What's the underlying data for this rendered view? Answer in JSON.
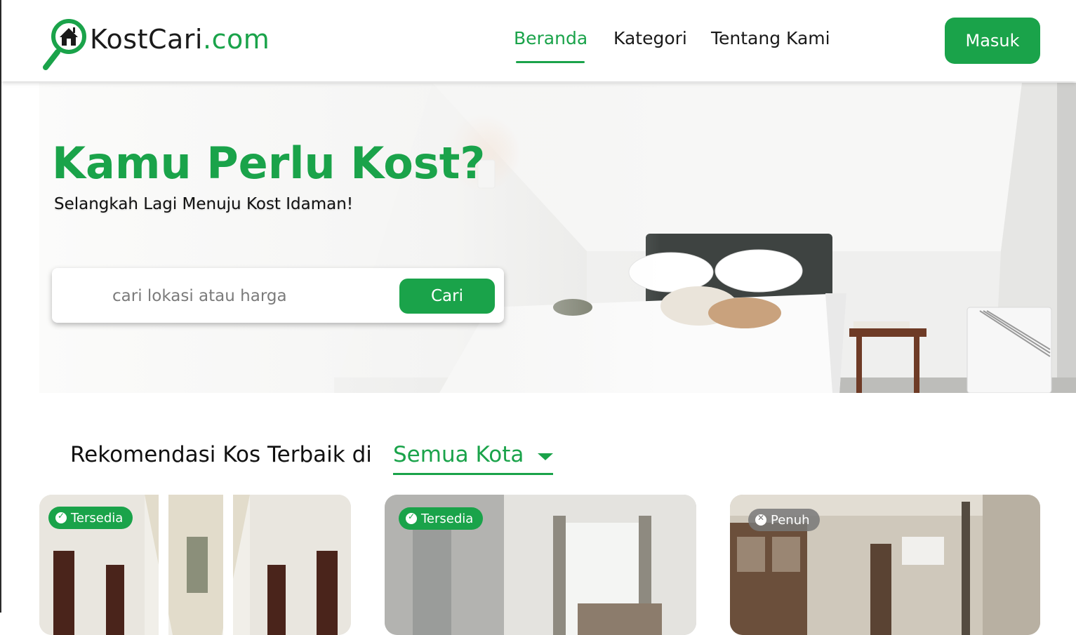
{
  "brand": {
    "name": "KostCari",
    "tld": ".com",
    "primary_color": "#1aa34a",
    "icon": "house-magnifier-icon"
  },
  "nav": {
    "items": [
      {
        "label": "Beranda",
        "active": true
      },
      {
        "label": "Kategori",
        "active": false
      },
      {
        "label": "Tentang Kami",
        "active": false
      }
    ],
    "login_label": "Masuk"
  },
  "hero": {
    "title": "Kamu Perlu Kost?",
    "subtitle": "Selangkah Lagi Menuju Kost Idaman!",
    "search": {
      "placeholder": "cari lokasi atau harga",
      "value": "",
      "button_label": "Cari"
    }
  },
  "recommendations": {
    "title": "Rekomendasi Kos Terbaik di",
    "city": "Semua Kota",
    "cards": [
      {
        "status": "Tersedia",
        "status_icon": "check-circle-icon"
      },
      {
        "status": "Tersedia",
        "status_icon": "check-circle-icon"
      },
      {
        "status": "Penuh",
        "status_icon": "x-circle-icon"
      }
    ]
  }
}
